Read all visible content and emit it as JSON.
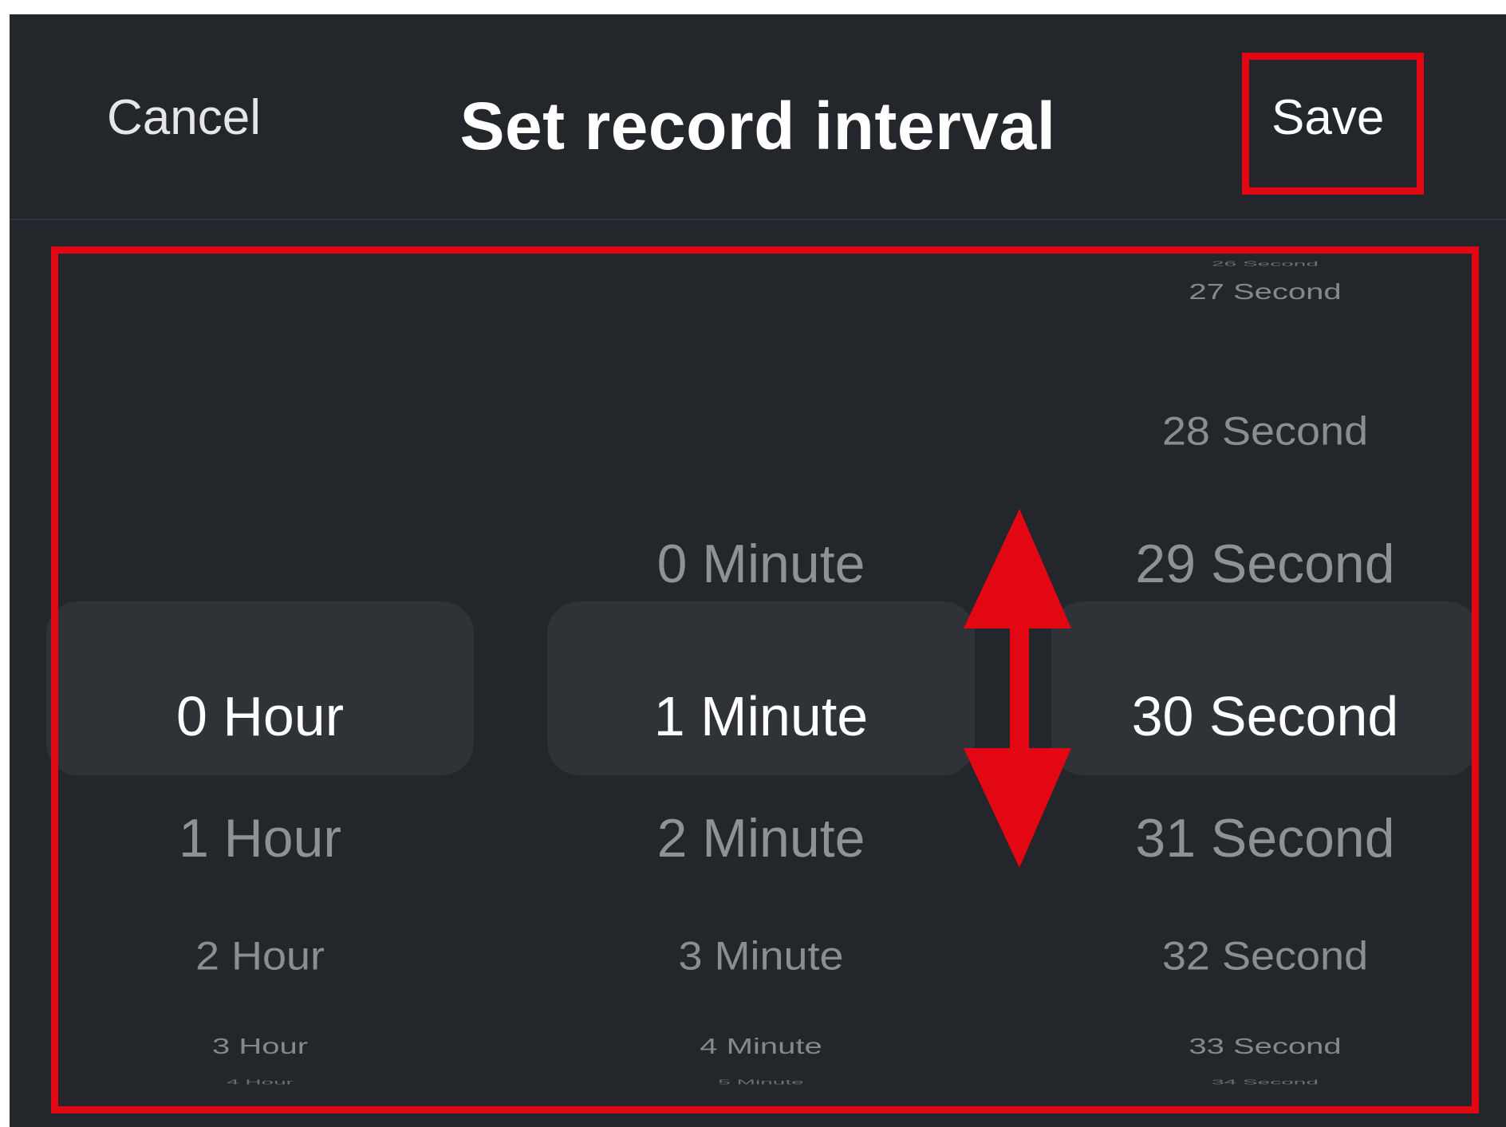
{
  "header": {
    "cancel_label": "Cancel",
    "title": "Set record interval",
    "save_label": "Save"
  },
  "picker": {
    "hours": {
      "items": [
        "1 Hour",
        "2 Hour",
        "3 Hour",
        "4 Hour"
      ],
      "selected": "0 Hour"
    },
    "minutes": {
      "items": [
        "0 Minute",
        "2 Minute",
        "3 Minute",
        "4 Minute",
        "5 Minute"
      ],
      "selected": "1 Minute"
    },
    "seconds": {
      "items": [
        "26 Second",
        "27 Second",
        "28 Second",
        "29 Second",
        "31 Second",
        "32 Second",
        "33 Second",
        "34 Second"
      ],
      "selected": "30 Second"
    }
  },
  "annotations": {
    "highlight_color": "#e30613",
    "arrow_icon": "double-vertical-arrow-icon"
  },
  "colors": {
    "background": "#23262a",
    "selection_band": "#2f3237",
    "selected_text": "#ffffff",
    "faded_text": "#8e9196"
  }
}
